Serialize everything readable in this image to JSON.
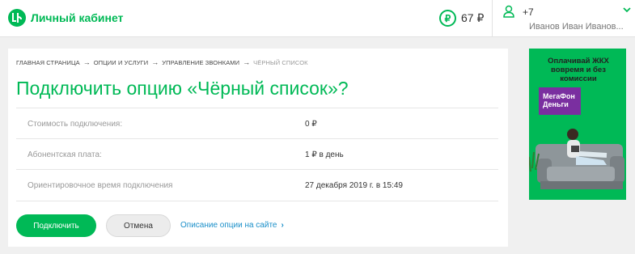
{
  "header": {
    "logo_text": "Личный кабинет",
    "balance": "67 ₽",
    "currency_icon": "₽",
    "account_phone": "+7",
    "account_name": "Иванов Иван Иванов..."
  },
  "breadcrumb": [
    {
      "label": "Главная страница"
    },
    {
      "label": "Опции и услуги"
    },
    {
      "label": "Управление звонками"
    },
    {
      "label": "Чёрный список"
    }
  ],
  "page_title": "Подключить опцию «Чёрный список»?",
  "details": [
    {
      "label": "Стоимость подключения:",
      "value": "0 ₽"
    },
    {
      "label": "Абонентская плата:",
      "value": "1 ₽ в день"
    },
    {
      "label": "Ориентировочное время подключения",
      "value": "27 декабря 2019 г. в 15:49"
    }
  ],
  "actions": {
    "connect_label": "Подключить",
    "cancel_label": "Отмена",
    "description_link": "Описание опции на сайте"
  },
  "ad": {
    "headline": "Оплачивай ЖКХ вовремя и без комиссии",
    "badge": "МегаФон Деньги"
  },
  "colors": {
    "brand_green": "#00b956",
    "link_blue": "#1a8fc9",
    "badge_purple": "#7a2fa0"
  }
}
